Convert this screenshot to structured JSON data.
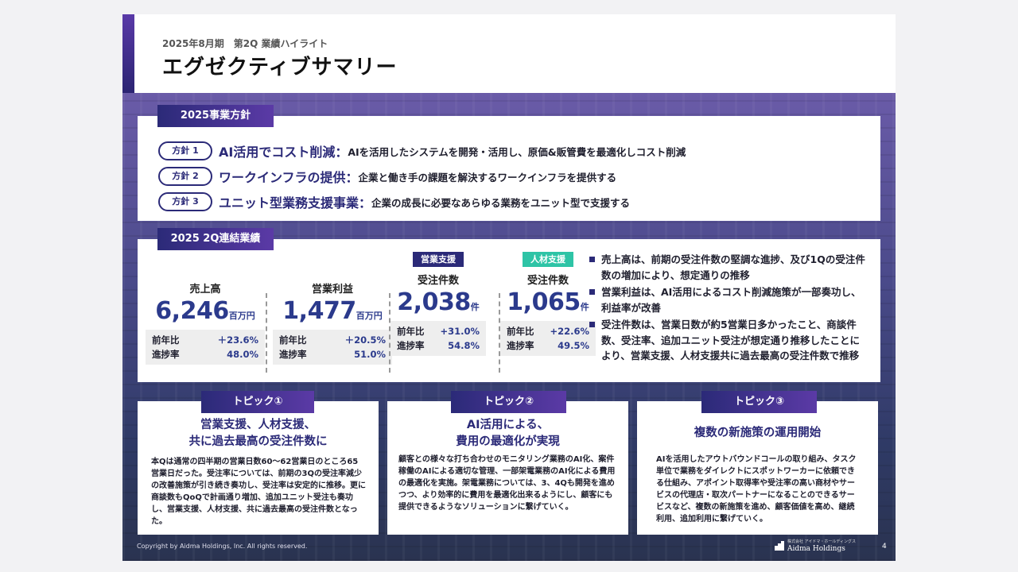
{
  "header": {
    "subtitle": "2025年8月期　第2Q 業績ハイライト",
    "title": "エグゼクティブサマリー"
  },
  "policy": {
    "tab": "2025事業方針",
    "items": [
      {
        "pill": "方針 1",
        "head": "AI活用でコスト削減：",
        "desc": "AIを活用したシステムを開発・活用し、原価&販管費を最適化しコスト削減"
      },
      {
        "pill": "方針 2",
        "head": "ワークインフラの提供：",
        "desc": "企業と働き手の課題を解決するワークインフラを提供する"
      },
      {
        "pill": "方針 3",
        "head": "ユニット型業務支援事業：",
        "desc": "企業の成長に必要なあらゆる業務をユニット型で支援する"
      }
    ]
  },
  "results": {
    "tab": "2025 2Q連結業績",
    "kpis": [
      {
        "badge": "",
        "label": "売上高",
        "value": "6,246",
        "unit": "百万円",
        "yoy_label": "前年比",
        "yoy": "＋23.6%",
        "progress_label": "進捗率",
        "progress": "48.0%"
      },
      {
        "badge": "",
        "label": "営業利益",
        "value": "1,477",
        "unit": "百万円",
        "yoy_label": "前年比",
        "yoy": "＋20.5%",
        "progress_label": "進捗率",
        "progress": "51.0%"
      },
      {
        "badge": "営業支援",
        "label": "受注件数",
        "value": "2,038",
        "unit": "件",
        "yoy_label": "前年比",
        "yoy": "+31.0%",
        "progress_label": "進捗率",
        "progress": "54.8%"
      },
      {
        "badge": "人材支援",
        "label": "受注件数",
        "value": "1,065",
        "unit": "件",
        "yoy_label": "前年比",
        "yoy": "+22.6%",
        "progress_label": "進捗率",
        "progress": "49.5%"
      }
    ],
    "badge_colors": [
      "#2b2a78",
      "#2ec4a6"
    ],
    "bullets": [
      "売上高は、前期の受注件数の堅調な進捗、及び1Qの受注件数の増加により、想定通りの推移",
      "営業利益は、AI活用によるコスト削減施策が一部奏功し、利益率が改善",
      "受注件数は、営業日数が約5営業日多かったこと、商談件数、受注率、追加ユニット受注が想定通り推移したことにより、営業支援、人材支援共に過去最高の受注件数で推移"
    ]
  },
  "topics": [
    {
      "tab": "トピック①",
      "head_line1": "営業支援、人材支援、",
      "head_line2": "共に過去最高の受注件数に",
      "body": "本Qは通常の四半期の営業日数60～62営業日のところ65営業日だった。受注率については、前期の3Qの受注率減少の改善施策が引き続き奏功し、受注率は安定的に推移。更に商談数もQoQで計画通り増加、追加ユニット受注も奏功し、営業支援、人材支援、共に過去最高の受注件数となった。"
    },
    {
      "tab": "トピック②",
      "head_line1": "AI活用による、",
      "head_line2": "費用の最適化が実現",
      "body": "顧客との様々な打ち合わせのモニタリング業務のAI化、案件稼働のAIによる適切な管理、一部架電業務のAI化による費用の最適化を実施。架電業務については、3、4Qも開発を進めつつ、より効率的に費用を最適化出来るようにし、顧客にも提供できるようなソリューションに繋げていく。"
    },
    {
      "tab": "トピック③",
      "head_line1": "複数の新施策の運用開始",
      "head_line2": "",
      "body": "AIを活用したアウトバウンドコールの取り組み、タスク単位で業務をダイレクトにスポットワーカーに依頼できる仕組み、アポイント取得率や受注率の高い商材やサービスの代理店・取次パートナーになることのできるサービスなど、複数の新施策を進め、顧客価値を高め、継続利用、追加利用に繋げていく。"
    }
  ],
  "footer": {
    "copyright": "Copyright by Aidma Holdings, Inc. All rights reserved.",
    "logo_small": "株式会社 アイドマ・ホールディングス",
    "logo_name": "Aidma Holdings",
    "page": "4"
  }
}
